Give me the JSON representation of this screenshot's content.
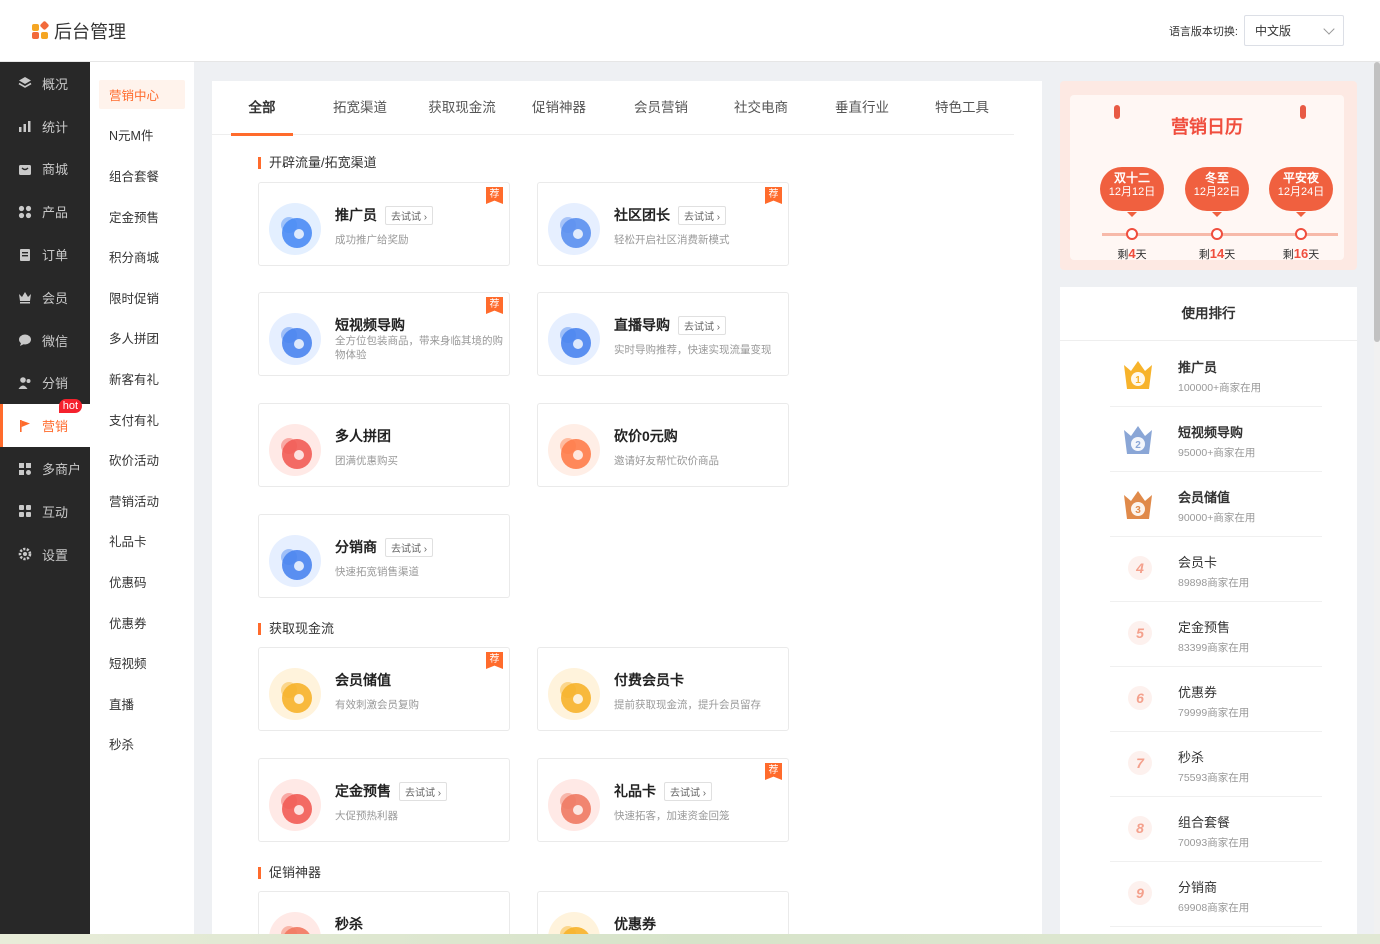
{
  "header": {
    "title": "后台管理",
    "lang_label": "语言版本切换:",
    "lang_value": "中文版"
  },
  "nav": [
    {
      "label": "概况",
      "icon": "layers-icon"
    },
    {
      "label": "统计",
      "icon": "chart-icon"
    },
    {
      "label": "商城",
      "icon": "shop-icon"
    },
    {
      "label": "产品",
      "icon": "grid-icon"
    },
    {
      "label": "订单",
      "icon": "order-icon"
    },
    {
      "label": "会员",
      "icon": "crown-icon"
    },
    {
      "label": "微信",
      "icon": "chat-icon"
    },
    {
      "label": "分销",
      "icon": "users-icon"
    },
    {
      "label": "营销",
      "icon": "flag-icon",
      "badge": "hot"
    },
    {
      "label": "多商户",
      "icon": "store-icon"
    },
    {
      "label": "互动",
      "icon": "apps-icon"
    },
    {
      "label": "设置",
      "icon": "gear-icon"
    }
  ],
  "subnav": [
    "营销中心",
    "N元M件",
    "组合套餐",
    "定金预售",
    "积分商城",
    "限时促销",
    "多人拼团",
    "新客有礼",
    "支付有礼",
    "砍价活动",
    "营销活动",
    "礼品卡",
    "优惠码",
    "优惠券",
    "短视频",
    "直播",
    "秒杀"
  ],
  "tabs": [
    "全部",
    "拓宽渠道",
    "获取现金流",
    "促销神器",
    "会员营销",
    "社交电商",
    "垂直行业",
    "特色工具"
  ],
  "sections": [
    {
      "title": "开辟流量/拓宽渠道"
    },
    {
      "title": "获取现金流"
    },
    {
      "title": "促销神器"
    }
  ],
  "try_label": "去试试",
  "rec_label": "荐",
  "cards": [
    {
      "title": "推广员",
      "desc": "成功推广给奖励",
      "try": true,
      "rec": true,
      "icon": "megaphone-icon"
    },
    {
      "title": "社区团长",
      "desc": "轻松开启社区消费新模式",
      "try": true,
      "rec": true,
      "icon": "community-icon"
    },
    {
      "title": "短视频导购",
      "desc": "全方位包装商品，带来身临其境的购物体验",
      "try": false,
      "rec": true,
      "icon": "video-bag-icon"
    },
    {
      "title": "直播导购",
      "desc": "实时导购推荐，快速实现流量变现",
      "try": true,
      "rec": false,
      "icon": "clapper-icon"
    },
    {
      "title": "多人拼团",
      "desc": "团满优惠购买",
      "try": false,
      "rec": false,
      "icon": "group-icon"
    },
    {
      "title": "砍价0元购",
      "desc": "邀请好友帮忙砍价商品",
      "try": false,
      "rec": false,
      "icon": "price-tag-icon"
    },
    {
      "title": "分销商",
      "desc": "快速拓宽销售渠道",
      "try": true,
      "rec": false,
      "icon": "distributor-icon"
    },
    {
      "title": "会员储值",
      "desc": "有效刺激会员复购",
      "try": false,
      "rec": true,
      "icon": "coin-icon"
    },
    {
      "title": "付费会员卡",
      "desc": "提前获取现金流，提升会员留存",
      "try": false,
      "rec": false,
      "icon": "vip-card-icon"
    },
    {
      "title": "定金预售",
      "desc": "大促预热利器",
      "try": true,
      "rec": false,
      "icon": "deposit-icon"
    },
    {
      "title": "礼品卡",
      "desc": "快速拓客，加速资金回笼",
      "try": true,
      "rec": true,
      "icon": "gift-icon"
    },
    {
      "title": "秒杀",
      "desc": "",
      "try": false,
      "rec": false,
      "icon": "clock-icon"
    },
    {
      "title": "优惠券",
      "desc": "",
      "try": false,
      "rec": false,
      "icon": "coupon-icon"
    }
  ],
  "calendar": {
    "title": "营销日历",
    "events": [
      {
        "name": "双十二",
        "date": "12月12日",
        "prefix": "剩",
        "days": "4",
        "suffix": "天"
      },
      {
        "name": "冬至",
        "date": "12月22日",
        "prefix": "剩",
        "days": "14",
        "suffix": "天"
      },
      {
        "name": "平安夜",
        "date": "12月24日",
        "prefix": "剩",
        "days": "16",
        "suffix": "天"
      }
    ]
  },
  "ranking": {
    "title": "使用排行",
    "items": [
      {
        "rank": "1",
        "name": "推广员",
        "usage": "100000+商家在用"
      },
      {
        "rank": "2",
        "name": "短视频导购",
        "usage": "95000+商家在用"
      },
      {
        "rank": "3",
        "name": "会员储值",
        "usage": "90000+商家在用"
      },
      {
        "rank": "4",
        "name": "会员卡",
        "usage": "89898商家在用"
      },
      {
        "rank": "5",
        "name": "定金预售",
        "usage": "83399商家在用"
      },
      {
        "rank": "6",
        "name": "优惠券",
        "usage": "79999商家在用"
      },
      {
        "rank": "7",
        "name": "秒杀",
        "usage": "75593商家在用"
      },
      {
        "rank": "8",
        "name": "组合套餐",
        "usage": "70093商家在用"
      },
      {
        "rank": "9",
        "name": "分销商",
        "usage": "69908商家在用"
      }
    ]
  },
  "colors": {
    "accent": "#ff6b2c",
    "sidebar": "#282828",
    "calendar_red": "#f04e3e"
  }
}
